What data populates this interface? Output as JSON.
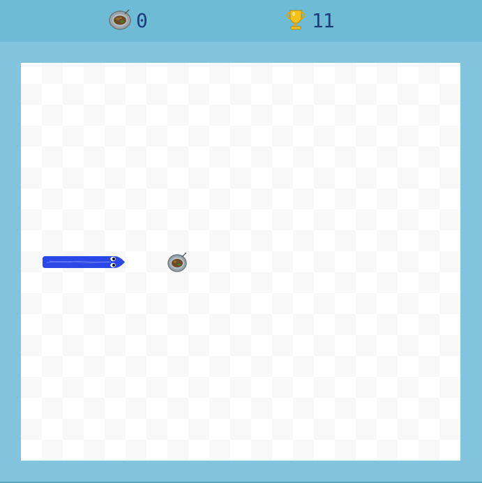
{
  "header": {
    "score": {
      "icon": "food-plate-icon",
      "value": "0"
    },
    "high_score": {
      "icon": "trophy-icon",
      "value": "11"
    }
  },
  "board": {
    "snake_color": "#2b47e8",
    "background_color": "#82c4dd",
    "board_color": "#ffffff"
  }
}
